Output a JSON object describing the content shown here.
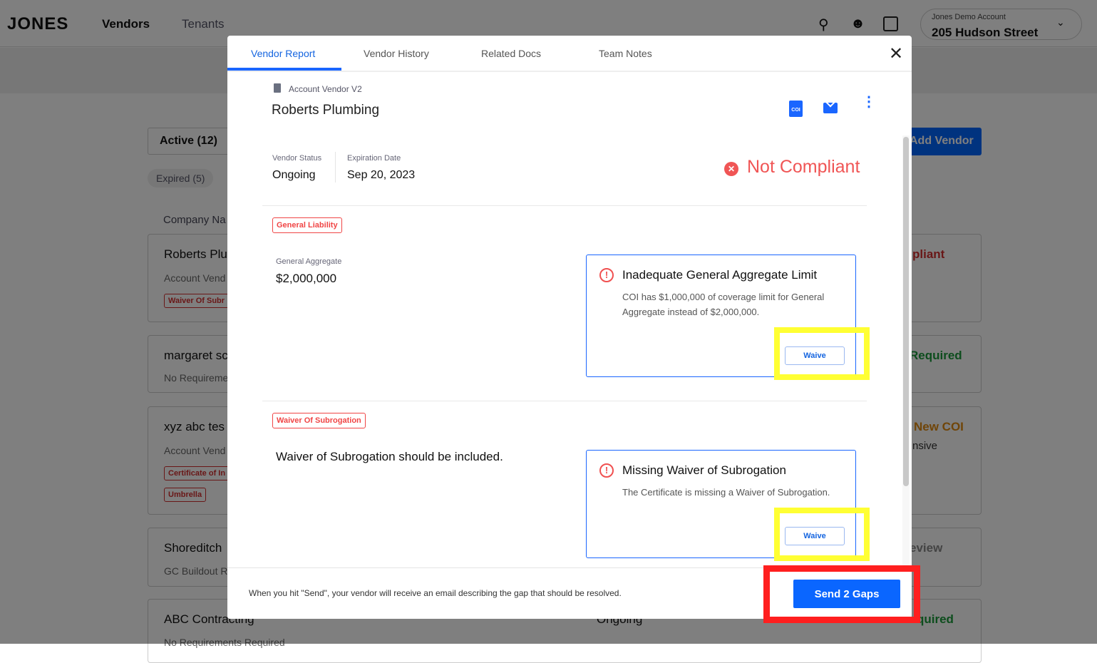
{
  "header": {
    "logo": "JONES",
    "nav": [
      "Vendors",
      "Tenants"
    ],
    "account_label": "Jones Demo Account",
    "account_name": "205 Hudson Street"
  },
  "background": {
    "filters": [
      "Active (12)",
      "Expired (5)"
    ],
    "add_vendor": "Add Vendor",
    "column_header": "Company Na",
    "cards": [
      {
        "name": "Roberts Plu",
        "sub": "Account Vend",
        "tags": [
          "Waiver Of Subr"
        ],
        "status": "pliant"
      },
      {
        "name": "margaret sc",
        "sub": "No Requireme",
        "tags": [],
        "status": "Required"
      },
      {
        "name": "xyz abc tes",
        "sub": "Account Vend",
        "tags": [
          "Certificate of In",
          "Umbrella"
        ],
        "status": "New COI",
        "status2": "nsive"
      },
      {
        "name": "Shoreditch",
        "sub": "GC Buildout Re",
        "tags": [],
        "status": "eview"
      },
      {
        "name": "ABC Contracting",
        "sub": "No Requirements Required",
        "tags": [],
        "mid": "Ongoing",
        "status": "quired"
      }
    ]
  },
  "modal": {
    "tabs": [
      "Vendor Report",
      "Vendor History",
      "Related Docs",
      "Team Notes"
    ],
    "doc_type": "Account Vendor V2",
    "vendor_name": "Roberts Plumbing",
    "vendor_status_label": "Vendor Status",
    "vendor_status": "Ongoing",
    "expiration_label": "Expiration Date",
    "expiration": "Sep 20, 2023",
    "compliance": "Not Compliant",
    "coi_icon_text": "COI",
    "sections": [
      {
        "tag": "General Liability",
        "field_label": "General Aggregate",
        "field_value": "$2,000,000",
        "issue_title": "Inadequate General Aggregate Limit",
        "issue_desc": "COI has $1,000,000 of coverage limit for General Aggregate instead of $2,000,000.",
        "action": "Waive"
      },
      {
        "tag": "Waiver Of Subrogation",
        "field_value": "Waiver of Subrogation should be included.",
        "issue_title": "Missing Waiver of Subrogation",
        "issue_desc": "The Certificate is missing a Waiver of Subrogation.",
        "action": "Waive"
      }
    ],
    "footer_text": "When you hit \"Send\", your vendor will receive an email describing the gap that should be resolved.",
    "send_label": "Send 2 Gaps"
  },
  "colors": {
    "accent": "#0a66ff",
    "error": "#f04545",
    "highlight_yellow": "#ffff33",
    "highlight_red": "#ff1f1f"
  }
}
